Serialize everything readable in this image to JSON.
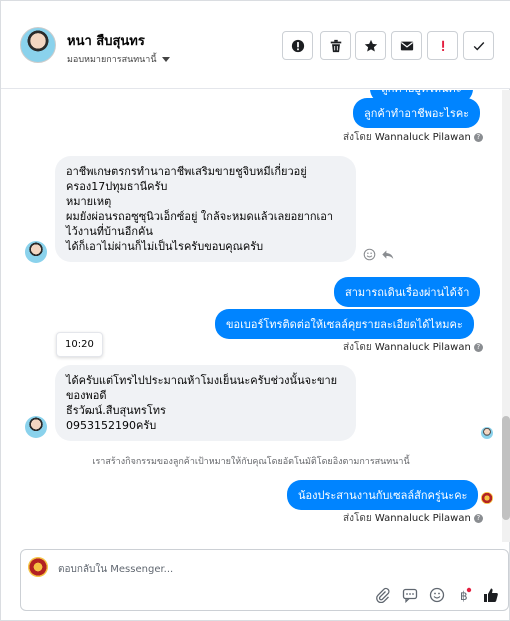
{
  "header": {
    "contact_name": "หนา สืบสุนทร",
    "assign_label": "มอบหมายการสนทนานี้",
    "actions": [
      {
        "name": "report-button",
        "icon": "alert-circle-icon"
      },
      {
        "name": "delete-button",
        "icon": "trash-icon"
      },
      {
        "name": "star-button",
        "icon": "star-icon"
      },
      {
        "name": "mark-unread-button",
        "icon": "envelope-icon"
      },
      {
        "name": "spam-button",
        "icon": "exclamation-icon"
      },
      {
        "name": "done-button",
        "icon": "check-icon"
      }
    ]
  },
  "messages": {
    "out_top_partial": "ลูกค้าอยู่ที่ไหนคะ",
    "out_1": "ลูกค้าทำอาชีพอะไรคะ",
    "sent_by_label": "ส่งโดย",
    "sender_name": "Wannaluck Pilawan",
    "in_1_lines": [
      "อาชีพเกษตรกรทำนาอาชีพเสริมขายชูจิบหมีเกี่ยวอยู่",
      "ครอง17ปทุมธานีครับ",
      "หมายเหตุ",
      "ผมยังผ่อนรถอซูซุนิวเอ็กซ์อยู่ ใกล้จะหมดแล้วเลยอยากเอา",
      "ไว้งานที่บ้านอีกคัน",
      "ได้ก็เอาไม่ผ่านก็ไม่เป็นไรครับขอบคุณครับ"
    ],
    "out_2": "สามารถเดินเรื่องผ่านได้จ้า",
    "out_3": "ขอเบอร์โทรติดต่อให้เซลล์คุยรายละเอียดได้ไหมคะ",
    "time_chip": "10:20",
    "in_2_lines": [
      "ได้ครับแต่โทรไปประมาณห้าโมงเย็นนะครับช่วงนั้นจะขาย",
      "ของพอดี",
      "ธีรวัฒน์.สืบสุนทรโทร",
      "0953152190ครับ"
    ],
    "system_note": "เราสร้างกิจกรรมของลูกค้าเป้าหมายให้กับคุณโดยอัตโนมัติโดยอิงตามการสนทนานี้",
    "out_4": "น้องประสานงานกับเซลล์สักครู่นะคะ"
  },
  "composer": {
    "placeholder": "ตอบกลับใน Messenger..."
  },
  "colors": {
    "brand_blue": "#0084ff",
    "spam_red": "#e41e3f"
  }
}
